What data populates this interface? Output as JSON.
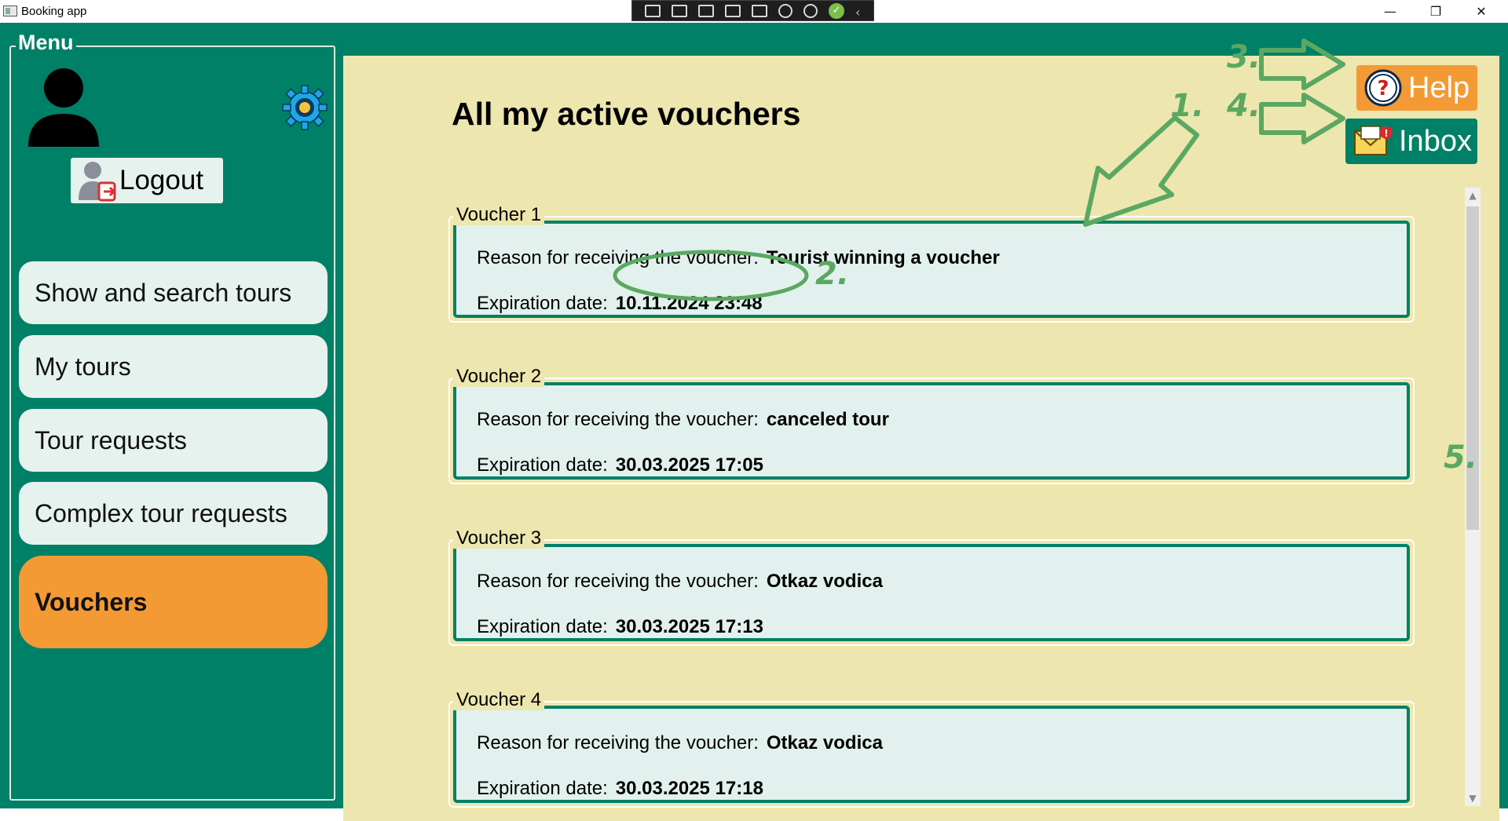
{
  "window": {
    "title": "Booking app",
    "controls": {
      "minimize": "—",
      "restore": "❐",
      "close": "✕"
    }
  },
  "menu": {
    "title": "Menu",
    "logout_label": "Logout",
    "items": [
      {
        "label": "Show and search tours",
        "active": false
      },
      {
        "label": "My tours",
        "active": false
      },
      {
        "label": "Tour requests",
        "active": false
      },
      {
        "label": "Complex tour requests",
        "active": false
      },
      {
        "label": "Vouchers",
        "active": true
      }
    ]
  },
  "header": {
    "title": "All my active vouchers",
    "help_label": "Help",
    "inbox_label": "Inbox"
  },
  "vouchers": {
    "reason_label": "Reason for receiving the voucher:",
    "date_label": "Expiration date:",
    "items": [
      {
        "name": "Voucher 1",
        "reason": "Tourist winning a voucher",
        "expiration": "10.11.2024 23:48"
      },
      {
        "name": "Voucher 2",
        "reason": "canceled tour",
        "expiration": "30.03.2025 17:05"
      },
      {
        "name": "Voucher 3",
        "reason": "Otkaz vodica",
        "expiration": "30.03.2025 17:13"
      },
      {
        "name": "Voucher 4",
        "reason": "Otkaz vodica",
        "expiration": "30.03.2025 17:18"
      }
    ]
  },
  "annotations": {
    "labels": [
      "1.",
      "2.",
      "3.",
      "4.",
      "5."
    ],
    "color": "#5aa862"
  },
  "colors": {
    "window_bg": "#008066",
    "content_bg": "#ede6ae",
    "accent_orange": "#f39a35",
    "menu_item_bg": "#e6f2ee",
    "voucher_bg": "#e2f1ed"
  }
}
